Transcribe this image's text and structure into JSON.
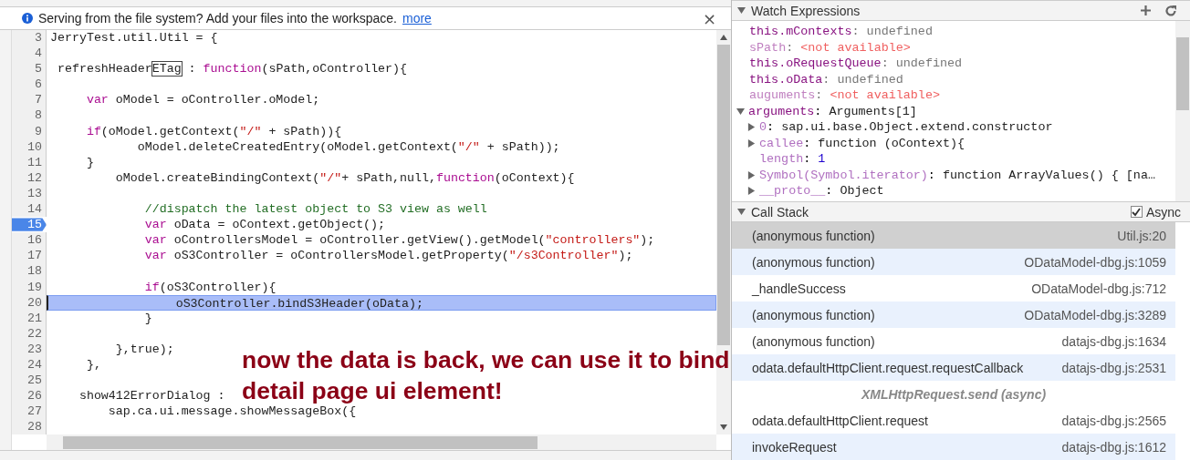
{
  "infobar": {
    "message": "Serving from the file system? Add your files into the workspace.",
    "link": "more",
    "close": "×"
  },
  "editor": {
    "lines": [
      {
        "number": "3",
        "breakpoint": false,
        "current": false,
        "segments": [
          {
            "kind": "plain",
            "text": "JerryTest.util.Util = {"
          }
        ]
      },
      {
        "number": "4",
        "breakpoint": false,
        "current": false
      },
      {
        "number": "5",
        "breakpoint": false,
        "current": false,
        "segments": [
          {
            "kind": "plain",
            "text": " refreshHeader"
          },
          {
            "kind": "boxed",
            "text": "ETag"
          },
          {
            "kind": "plain",
            "text": " : "
          },
          {
            "kind": "keyword",
            "text": "function"
          },
          {
            "kind": "plain",
            "text": "(sPath,oController){"
          }
        ]
      },
      {
        "number": "6",
        "breakpoint": false,
        "current": false
      },
      {
        "number": "7",
        "breakpoint": false,
        "current": false,
        "segments": [
          {
            "kind": "keyword",
            "text": "     var"
          },
          {
            "kind": "plain",
            "text": " oModel = oController.oModel;"
          }
        ]
      },
      {
        "number": "8",
        "breakpoint": false,
        "current": false
      },
      {
        "number": "9",
        "breakpoint": false,
        "current": false,
        "segments": [
          {
            "kind": "keyword",
            "text": "     if"
          },
          {
            "kind": "plain",
            "text": "(oModel.getContext("
          },
          {
            "kind": "string",
            "text": "\"/\""
          },
          {
            "kind": "plain",
            "text": " + sPath)){"
          }
        ]
      },
      {
        "number": "10",
        "breakpoint": false,
        "current": false,
        "segments": [
          {
            "kind": "plain",
            "text": "            oModel.deleteCreatedEntry(oModel.getContext("
          },
          {
            "kind": "string",
            "text": "\"/\""
          },
          {
            "kind": "plain",
            "text": " + sPath));"
          }
        ]
      },
      {
        "number": "11",
        "breakpoint": false,
        "current": false,
        "segments": [
          {
            "kind": "plain",
            "text": "     }"
          }
        ]
      },
      {
        "number": "12",
        "breakpoint": false,
        "current": false,
        "segments": [
          {
            "kind": "plain",
            "text": "         oModel.createBindingContext("
          },
          {
            "kind": "string",
            "text": "\"/\""
          },
          {
            "kind": "plain",
            "text": "+ sPath,null,"
          },
          {
            "kind": "keyword",
            "text": "function"
          },
          {
            "kind": "plain",
            "text": "(oContext){"
          }
        ]
      },
      {
        "number": "13",
        "breakpoint": false,
        "current": false
      },
      {
        "number": "14",
        "breakpoint": false,
        "current": false,
        "segments": [
          {
            "kind": "comment",
            "text": "             //dispatch the latest object to S3 view as well"
          }
        ]
      },
      {
        "number": "15",
        "breakpoint": true,
        "current": false,
        "segments": [
          {
            "kind": "keyword",
            "text": "             var"
          },
          {
            "kind": "plain",
            "text": " oData = oContext.getObject();"
          }
        ]
      },
      {
        "number": "16",
        "breakpoint": false,
        "current": false,
        "segments": [
          {
            "kind": "keyword",
            "text": "             var"
          },
          {
            "kind": "plain",
            "text": " oControllersModel = oController.getView().getModel("
          },
          {
            "kind": "string",
            "text": "\"controllers\""
          },
          {
            "kind": "plain",
            "text": ");"
          }
        ]
      },
      {
        "number": "17",
        "breakpoint": false,
        "current": false,
        "segments": [
          {
            "kind": "keyword",
            "text": "             var"
          },
          {
            "kind": "plain",
            "text": " oS3Controller = oControllersModel.getProperty("
          },
          {
            "kind": "string",
            "text": "\"/s3Controller\""
          },
          {
            "kind": "plain",
            "text": ");"
          }
        ]
      },
      {
        "number": "18",
        "breakpoint": false,
        "current": false
      },
      {
        "number": "19",
        "breakpoint": false,
        "current": false,
        "segments": [
          {
            "kind": "keyword",
            "text": "             if"
          },
          {
            "kind": "plain",
            "text": "(oS3Controller){"
          }
        ]
      },
      {
        "number": "20",
        "breakpoint": false,
        "current": true,
        "segments": [
          {
            "kind": "plain",
            "text": "                 oS3Controller.bindS3Header(oData);"
          }
        ]
      },
      {
        "number": "21",
        "breakpoint": false,
        "current": false,
        "segments": [
          {
            "kind": "plain",
            "text": "             }"
          }
        ]
      },
      {
        "number": "22",
        "breakpoint": false,
        "current": false
      },
      {
        "number": "23",
        "breakpoint": false,
        "current": false,
        "segments": [
          {
            "kind": "plain",
            "text": "         },true);"
          }
        ]
      },
      {
        "number": "24",
        "breakpoint": false,
        "current": false,
        "segments": [
          {
            "kind": "plain",
            "text": "     },"
          }
        ]
      },
      {
        "number": "25",
        "breakpoint": false,
        "current": false
      },
      {
        "number": "26",
        "breakpoint": false,
        "current": false,
        "segments": [
          {
            "kind": "plain",
            "text": "    show412ErrorDialog :"
          }
        ]
      },
      {
        "number": "27",
        "breakpoint": false,
        "current": false,
        "segments": [
          {
            "kind": "plain",
            "text": "        sap.ca.ui.message.showMessageBox({"
          }
        ]
      },
      {
        "number": "28",
        "breakpoint": false,
        "current": false
      }
    ]
  },
  "annotation": {
    "lines": [
      "now the data is back, we can use it to bind",
      "detail page ui element!"
    ]
  },
  "watch": {
    "title": "Watch Expressions",
    "separator": ":",
    "items": [
      {
        "name": "this.mContexts",
        "value": "undefined",
        "available": true
      },
      {
        "name": "sPath",
        "value": "<not available>",
        "available": false
      },
      {
        "name": "this.oRequestQueue",
        "value": "undefined",
        "available": true
      },
      {
        "name": "this.oData",
        "value": "undefined",
        "available": true
      },
      {
        "name": "auguments",
        "value": "<not available>",
        "available": false
      }
    ],
    "scope": {
      "name": "arguments",
      "value": "Arguments[1]",
      "expanded": true,
      "children": [
        {
          "name": "0",
          "value": "sap.ui.base.Object.extend.constructor",
          "expandable": true,
          "kind": "object"
        },
        {
          "name": "callee",
          "value": "function (oContext){",
          "expandable": true,
          "kind": "object"
        },
        {
          "name": "length",
          "value": "1",
          "expandable": false,
          "kind": "number"
        },
        {
          "name": "Symbol(Symbol.iterator)",
          "value": "function ArrayValues() { [na…",
          "expandable": true,
          "kind": "object"
        },
        {
          "name": "__proto__",
          "value": "Object",
          "expandable": true,
          "kind": "object"
        }
      ]
    }
  },
  "call_stack": {
    "title": "Call Stack",
    "async": {
      "label": "Async",
      "checked": true
    },
    "frames": [
      {
        "kind": "frame",
        "name": "(anonymous function)",
        "location": "Util.js:20",
        "selected": true
      },
      {
        "kind": "frame",
        "name": "(anonymous function)",
        "location": "ODataModel-dbg.js:1059",
        "selected": false
      },
      {
        "kind": "frame",
        "name": "_handleSuccess",
        "location": "ODataModel-dbg.js:712",
        "selected": false
      },
      {
        "kind": "frame",
        "name": "(anonymous function)",
        "location": "ODataModel-dbg.js:3289",
        "selected": false
      },
      {
        "kind": "frame",
        "name": "(anonymous function)",
        "location": "datajs-dbg.js:1634",
        "selected": false
      },
      {
        "kind": "frame",
        "name": "odata.defaultHttpClient.request.requestCallback",
        "location": "datajs-dbg.js:2531",
        "selected": false
      },
      {
        "kind": "async",
        "name": "XMLHttpRequest.send (async)"
      },
      {
        "kind": "frame",
        "name": "odata.defaultHttpClient.request",
        "location": "datajs-dbg.js:2565",
        "selected": false
      },
      {
        "kind": "frame",
        "name": "invokeRequest",
        "location": "datajs-dbg.js:1612",
        "selected": false
      }
    ]
  }
}
